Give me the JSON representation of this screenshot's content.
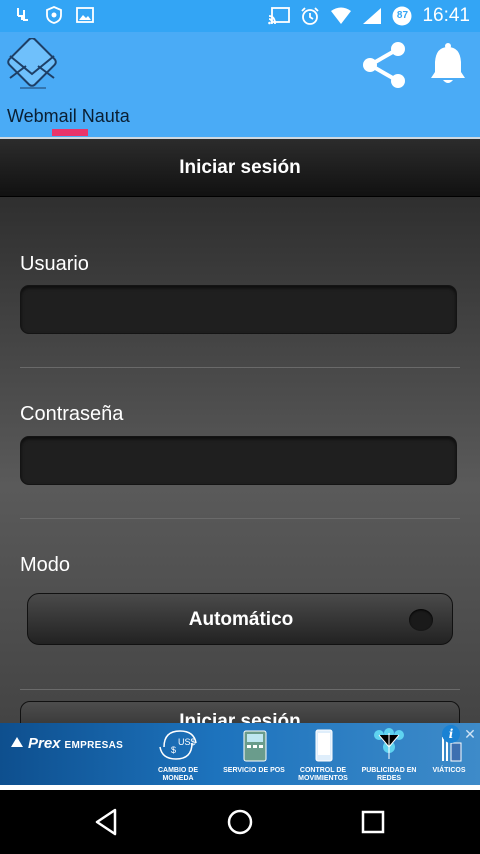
{
  "status_bar": {
    "time": "16:41",
    "battery_level": "87",
    "icons": [
      "voicemail-icon",
      "shield-icon",
      "image-icon",
      "cast-icon",
      "alarm-icon",
      "wifi-icon",
      "signal-icon",
      "battery-icon"
    ]
  },
  "header": {
    "logo_icon": "envelope-logo-icon",
    "share_icon": "share-icon",
    "notifications_icon": "bell-icon",
    "tab_label": "Webmail Nauta",
    "accent_color": "#e9356b",
    "header_color": "#4aabf6"
  },
  "title_bar": {
    "title": "Iniciar sesión"
  },
  "form": {
    "username_label": "Usuario",
    "username_value": "",
    "password_label": "Contraseña",
    "password_value": "",
    "mode_label": "Modo",
    "mode_value": "Automático",
    "login_label": "Iniciar sesión"
  },
  "ad": {
    "brand": "Prex",
    "brand_sub": "EMPRESAS",
    "currency": "US$",
    "items": [
      {
        "label": "CAMBIO DE MONEDA"
      },
      {
        "label": "SERVICIO DE POS"
      },
      {
        "label": "CONTROL DE MOVIMIENTOS"
      },
      {
        "label": "PUBLICIDAD EN REDES"
      },
      {
        "label": "VIÁTICOS"
      }
    ],
    "info_label": "i",
    "close_label": "✕"
  },
  "nav_bar": {
    "back_icon": "back-triangle-icon",
    "home_icon": "home-circle-icon",
    "recents_icon": "recents-square-icon"
  }
}
